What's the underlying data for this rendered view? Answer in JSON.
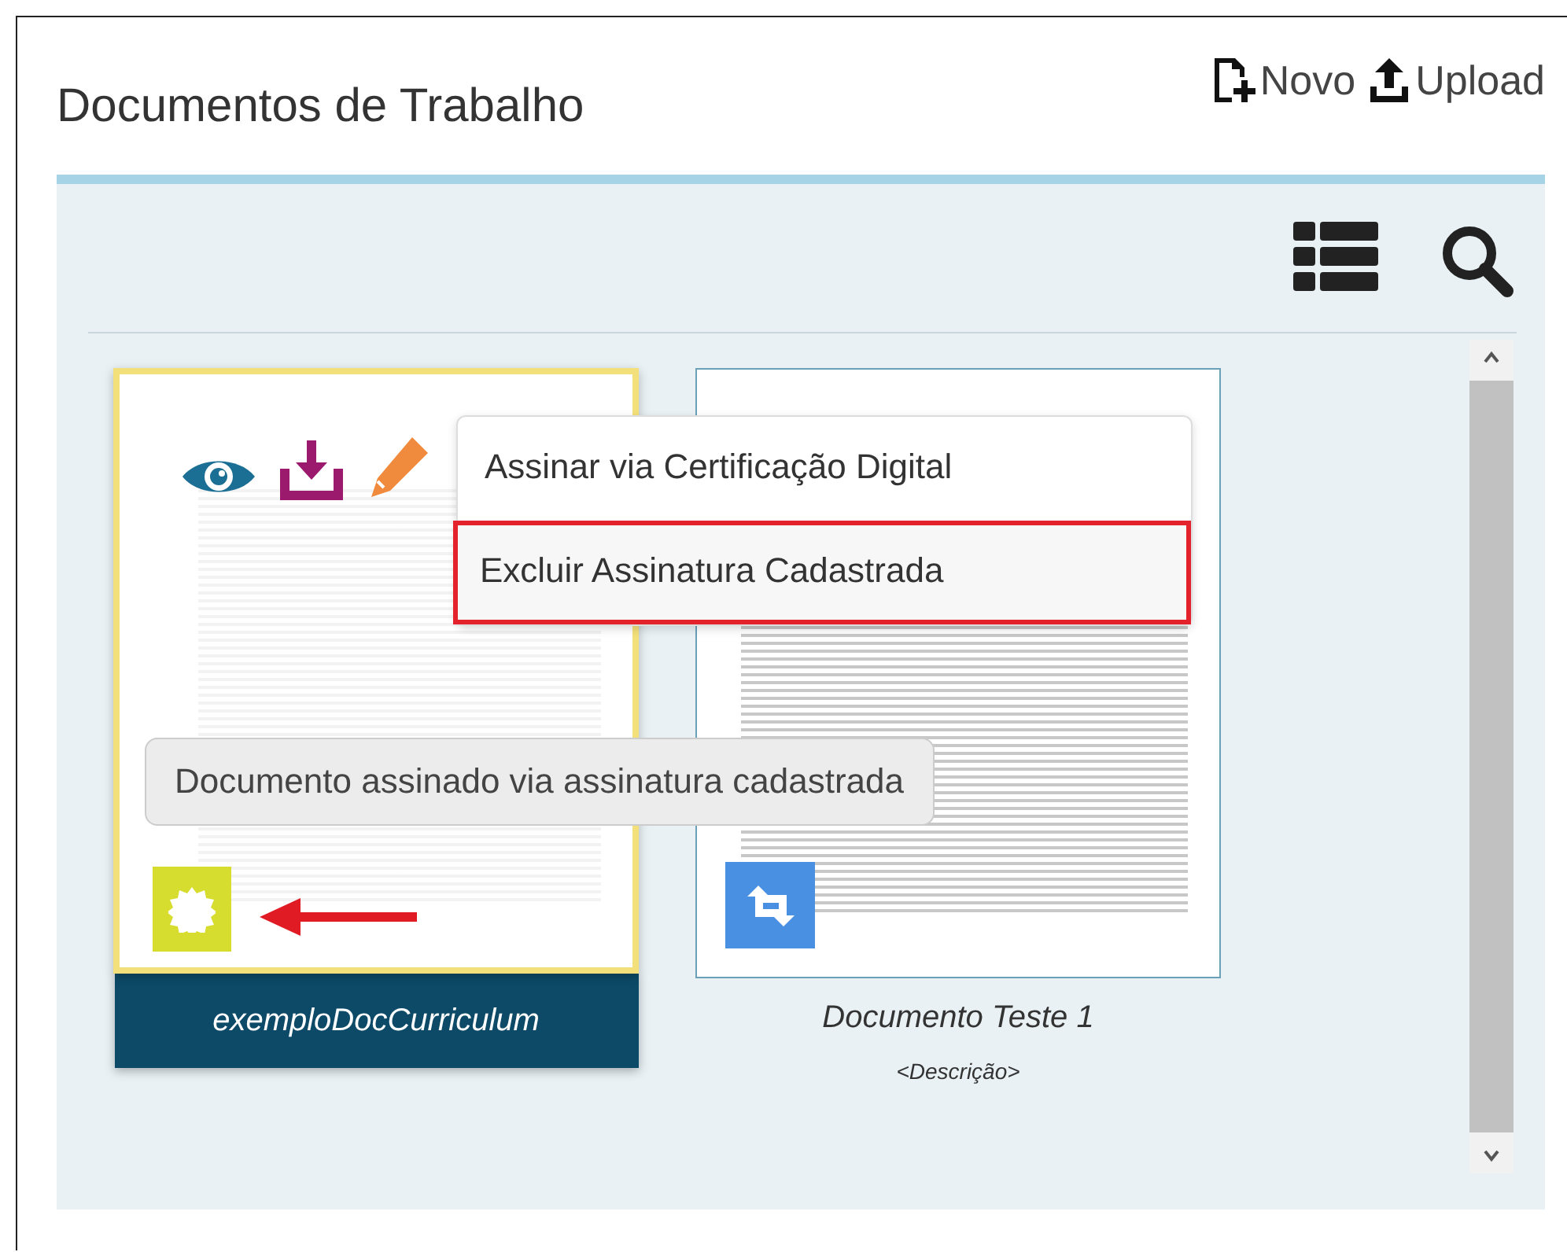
{
  "header": {
    "title": "Documentos de Trabalho",
    "actions": [
      {
        "kind": "new",
        "label": "Novo"
      },
      {
        "kind": "upload",
        "label": "Upload"
      }
    ]
  },
  "documents": [
    {
      "name": "exemploDocCurriculum",
      "selected": true,
      "kind": "signed"
    },
    {
      "name": "Documento Teste 1",
      "description": "<Descrição>",
      "selected": false,
      "kind": "sync"
    }
  ],
  "context_menu": {
    "items": [
      {
        "label": "Assinar via Certificação Digital",
        "highlighted": false
      },
      {
        "label": "Excluir Assinatura Cadastrada",
        "highlighted": true
      }
    ]
  },
  "tooltip": {
    "text": "Documento assinado via assinatura cadastrada"
  }
}
